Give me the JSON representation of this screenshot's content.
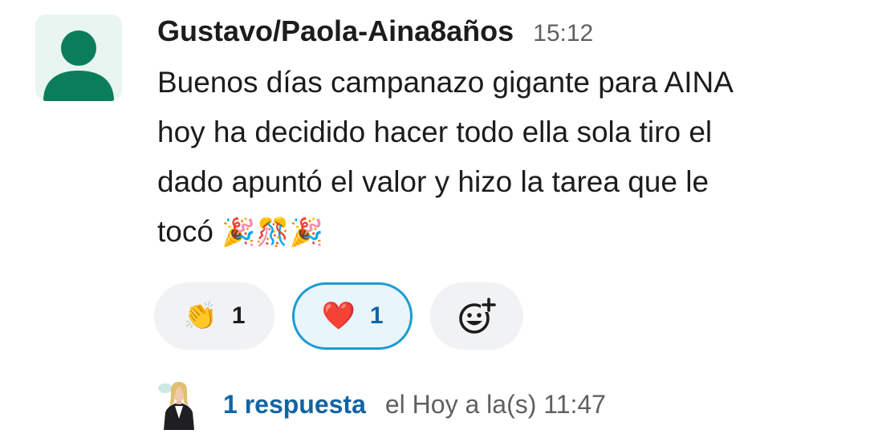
{
  "message": {
    "sender": "Gustavo/Paola-Aina8años",
    "time": "15:12",
    "text_lines": [
      "Buenos días campanazo gigante para AINA",
      "hoy ha decidido hacer todo ella sola tiro el",
      "dado apuntó el valor y hizo la tarea que le",
      "tocó"
    ],
    "trailing_emojis": [
      "🎉",
      "🎊",
      "🎉"
    ]
  },
  "reactions": [
    {
      "emoji": "👏",
      "count": "1",
      "selected": false
    },
    {
      "emoji": "❤️",
      "count": "1",
      "selected": true
    }
  ],
  "add_reaction": {
    "icon": "add-reaction-icon"
  },
  "thread": {
    "reply_count": "1 respuesta",
    "last_reply": "el Hoy a la(s) 11:47"
  },
  "colors": {
    "avatar_green": "#0b7d5d",
    "avatar_bg": "#e8f5f0",
    "link_blue": "#1264a3",
    "selected_border": "#1d9bd1",
    "pill_bg": "#f1f2f3"
  }
}
